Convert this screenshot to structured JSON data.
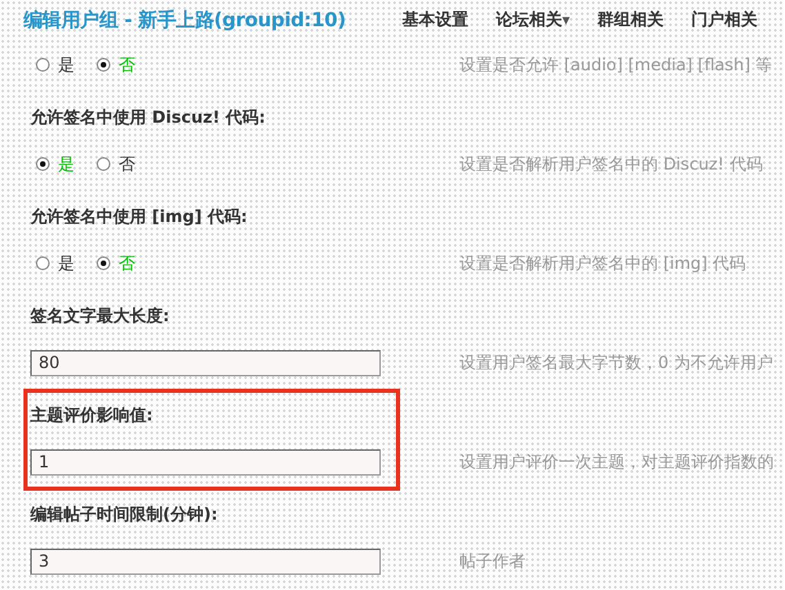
{
  "header": {
    "title": "编辑用户组 - 新手上路(groupid:10)",
    "nav": [
      {
        "label": "基本设置"
      },
      {
        "label": "论坛相关",
        "caret": "▾"
      },
      {
        "label": "群组相关"
      },
      {
        "label": "门户相关"
      }
    ]
  },
  "settings": [
    {
      "kind": "radio",
      "highlighted": false,
      "options": [
        {
          "label": "是",
          "selected": false
        },
        {
          "label": "否",
          "selected": true
        }
      ],
      "hint": "设置是否允许 [audio] [media] [flash] 等"
    },
    {
      "kind": "radio",
      "label": "允许签名中使用 Discuz! 代码:",
      "highlighted": false,
      "options": [
        {
          "label": "是",
          "selected": true
        },
        {
          "label": "否",
          "selected": false
        }
      ],
      "hint": "设置是否解析用户签名中的 Discuz! 代码"
    },
    {
      "kind": "radio",
      "label": "允许签名中使用 [img] 代码:",
      "highlighted": false,
      "options": [
        {
          "label": "是",
          "selected": false
        },
        {
          "label": "否",
          "selected": true
        }
      ],
      "hint": "设置是否解析用户签名中的 [img] 代码"
    },
    {
      "kind": "text",
      "label": "签名文字最大长度:",
      "highlighted": false,
      "value": "80",
      "hint": "设置用户签名最大字节数，0 为不允许用户"
    },
    {
      "kind": "text",
      "label": "主题评价影响值:",
      "highlighted": true,
      "value": "1",
      "hint": "设置用户评价一次主题，对主题评价指数的"
    },
    {
      "kind": "text",
      "label": "编辑帖子时间限制(分钟):",
      "highlighted": false,
      "value": "3",
      "hint": "帖子作者"
    }
  ]
}
